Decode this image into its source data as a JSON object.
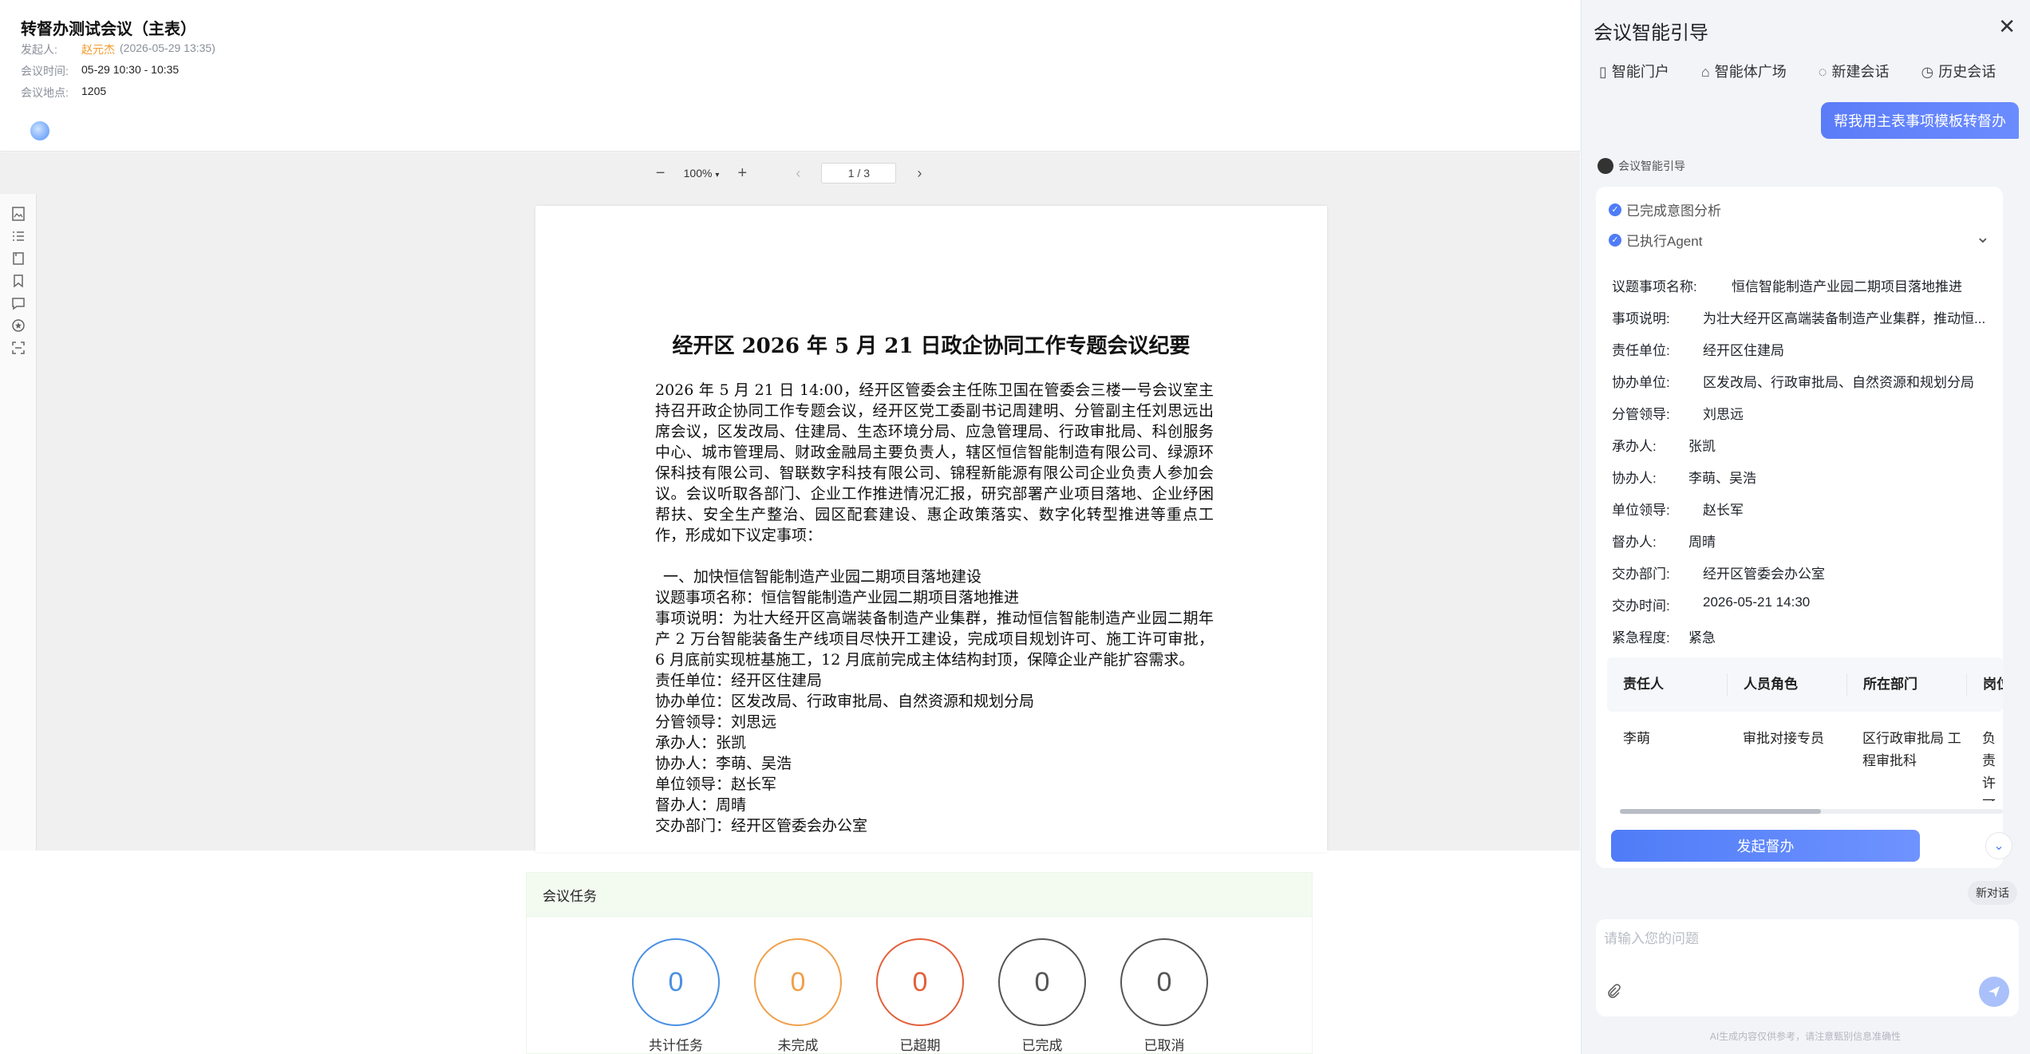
{
  "meeting": {
    "title": "转督办测试会议（主表）",
    "initiator_label": "发起人:",
    "initiator_name": "赵元杰",
    "initiator_time": "(2026-05-29 13:35)",
    "time_label": "会议时间:",
    "time_value": "05-29 10:30 - 10:35",
    "location_label": "会议地点:",
    "location_value": "1205"
  },
  "toolbar": {
    "zoom_out": "−",
    "zoom": "100%",
    "zoom_in": "+",
    "page": "1 / 3"
  },
  "document": {
    "title": "经开区 2026 年 5 月 21 日政企协同工作专题会议纪要",
    "intro": "2026 年 5 月 21 日 14:00，经开区管委会主任陈卫国在管委会三楼一号会议室主持召开政企协同工作专题会议，经开区党工委副书记周建明、分管副主任刘思远出席会议，区发改局、住建局、生态环境分局、应急管理局、行政审批局、科创服务中心、城市管理局、财政金融局主要负责人，辖区恒信智能制造有限公司、绿源环保科技有限公司、智联数字科技有限公司、锦程新能源有限公司企业负责人参加会议。会议听取各部门、企业工作推进情况汇报，研究部署产业项目落地、企业纾困帮扶、安全生产整治、园区配套建设、惠企政策落实、数字化转型推进等重点工作，形成如下议定事项：",
    "section1": "一、加快恒信智能制造产业园二期项目落地建设",
    "line_topic": "议题事项名称：恒信智能制造产业园二期项目落地推进",
    "line_desc": "事项说明：为壮大经开区高端装备制造产业集群，推动恒信智能制造产业园二期年产 2 万台智能装备生产线项目尽快开工建设，完成项目规划许可、施工许可审批，6 月底前实现桩基施工，12 月底前完成主体结构封顶，保障企业产能扩容需求。",
    "line_resp": "责任单位：经开区住建局",
    "line_coop": "协办单位：区发改局、行政审批局、自然资源和规划分局",
    "line_lead": "分管领导：刘思远",
    "line_handler": "承办人：张凯",
    "line_cohandler": "协办人：李萌、吴浩",
    "line_unitlead": "单位领导：赵长军",
    "line_supervisor": "督办人：周晴",
    "line_dept": "交办部门：经开区管委会办公室"
  },
  "tasks": {
    "header": "会议任务",
    "stats": [
      {
        "label": "共计任务",
        "value": "0",
        "color": "#4a90e2"
      },
      {
        "label": "未完成",
        "value": "0",
        "color": "#f0a04b"
      },
      {
        "label": "已超期",
        "value": "0",
        "color": "#e2603a"
      },
      {
        "label": "已完成",
        "value": "0",
        "color": "#555555"
      },
      {
        "label": "已取消",
        "value": "0",
        "color": "#555555"
      }
    ]
  },
  "assistant": {
    "title": "会议智能引导",
    "close": "✕",
    "nav": [
      "智能门户",
      "智能体广场",
      "新建会话",
      "历史会话"
    ],
    "user_message": "帮我用主表事项模板转督办",
    "bot_name": "会议智能引导",
    "status_1": "已完成意图分析",
    "status_2": "已执行Agent",
    "fields": [
      {
        "k": "议题事项名称:",
        "v": "恒信智能制造产业园二期项目落地推进"
      },
      {
        "k": "事项说明:",
        "v": "为壮大经开区高端装备制造产业集群，推动恒..."
      },
      {
        "k": "责任单位:",
        "v": "经开区住建局"
      },
      {
        "k": "协办单位:",
        "v": "区发改局、行政审批局、自然资源和规划分局"
      },
      {
        "k": "分管领导:",
        "v": "刘思远"
      },
      {
        "k": "承办人:",
        "v": "张凯"
      },
      {
        "k": "协办人:",
        "v": "李萌、吴浩"
      },
      {
        "k": "单位领导:",
        "v": "赵长军"
      },
      {
        "k": "督办人:",
        "v": "周晴"
      },
      {
        "k": "交办部门:",
        "v": "经开区管委会办公室"
      },
      {
        "k": "交办时间:",
        "v": "2026-05-21 14:30"
      },
      {
        "k": "紧急程度:",
        "v": "紧急"
      }
    ],
    "table": {
      "headers": [
        "责任人",
        "人员角色",
        "所在部门",
        "岗位"
      ],
      "row": [
        "李萌",
        "审批对接专员",
        "区行政审批局 工程审批科",
        "负责 许可 可研"
      ]
    },
    "cta": "发起督办",
    "new_chat": "新对话",
    "input_placeholder": "请输入您的问题",
    "disclaimer": "AI生成内容仅供参考，请注意甄别信息准确性"
  }
}
